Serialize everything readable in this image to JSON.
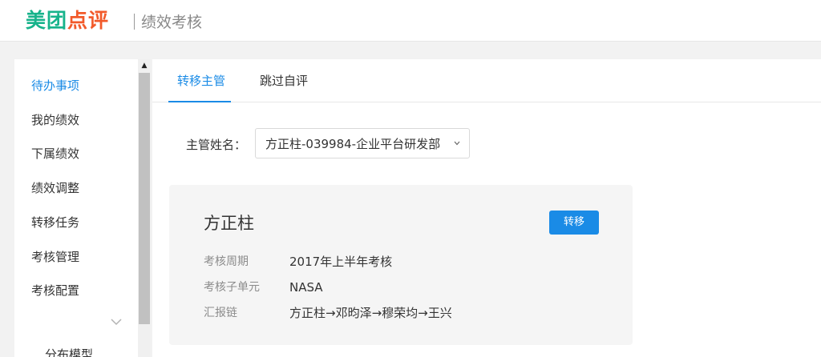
{
  "header": {
    "brand_part1": "美团",
    "brand_part2": "点评",
    "app_title": "绩效考核"
  },
  "sidebar": {
    "items": [
      {
        "label": "待办事项",
        "active": true
      },
      {
        "label": "我的绩效"
      },
      {
        "label": "下属绩效"
      },
      {
        "label": "绩效调整"
      },
      {
        "label": "转移任务"
      },
      {
        "label": "考核管理"
      },
      {
        "label": "考核配置"
      }
    ],
    "partial_item": "分布模型"
  },
  "tabs": [
    {
      "label": "转移主管",
      "active": true
    },
    {
      "label": "跳过自评"
    }
  ],
  "form": {
    "manager_label": "主管姓名：",
    "manager_value": "方正柱-039984-企业平台研发部"
  },
  "card": {
    "name": "方正柱",
    "transfer_button": "转移",
    "rows": [
      {
        "label": "考核周期",
        "value": "2017年上半年考核"
      },
      {
        "label": "考核子单元",
        "value": "NASA"
      },
      {
        "label": "汇报链",
        "value": "方正柱→邓昀泽→穆荣均→王兴"
      }
    ]
  },
  "colors": {
    "brand_green": "#17b38b",
    "brand_orange": "#f25a2a",
    "accent_blue": "#1a8be6"
  }
}
